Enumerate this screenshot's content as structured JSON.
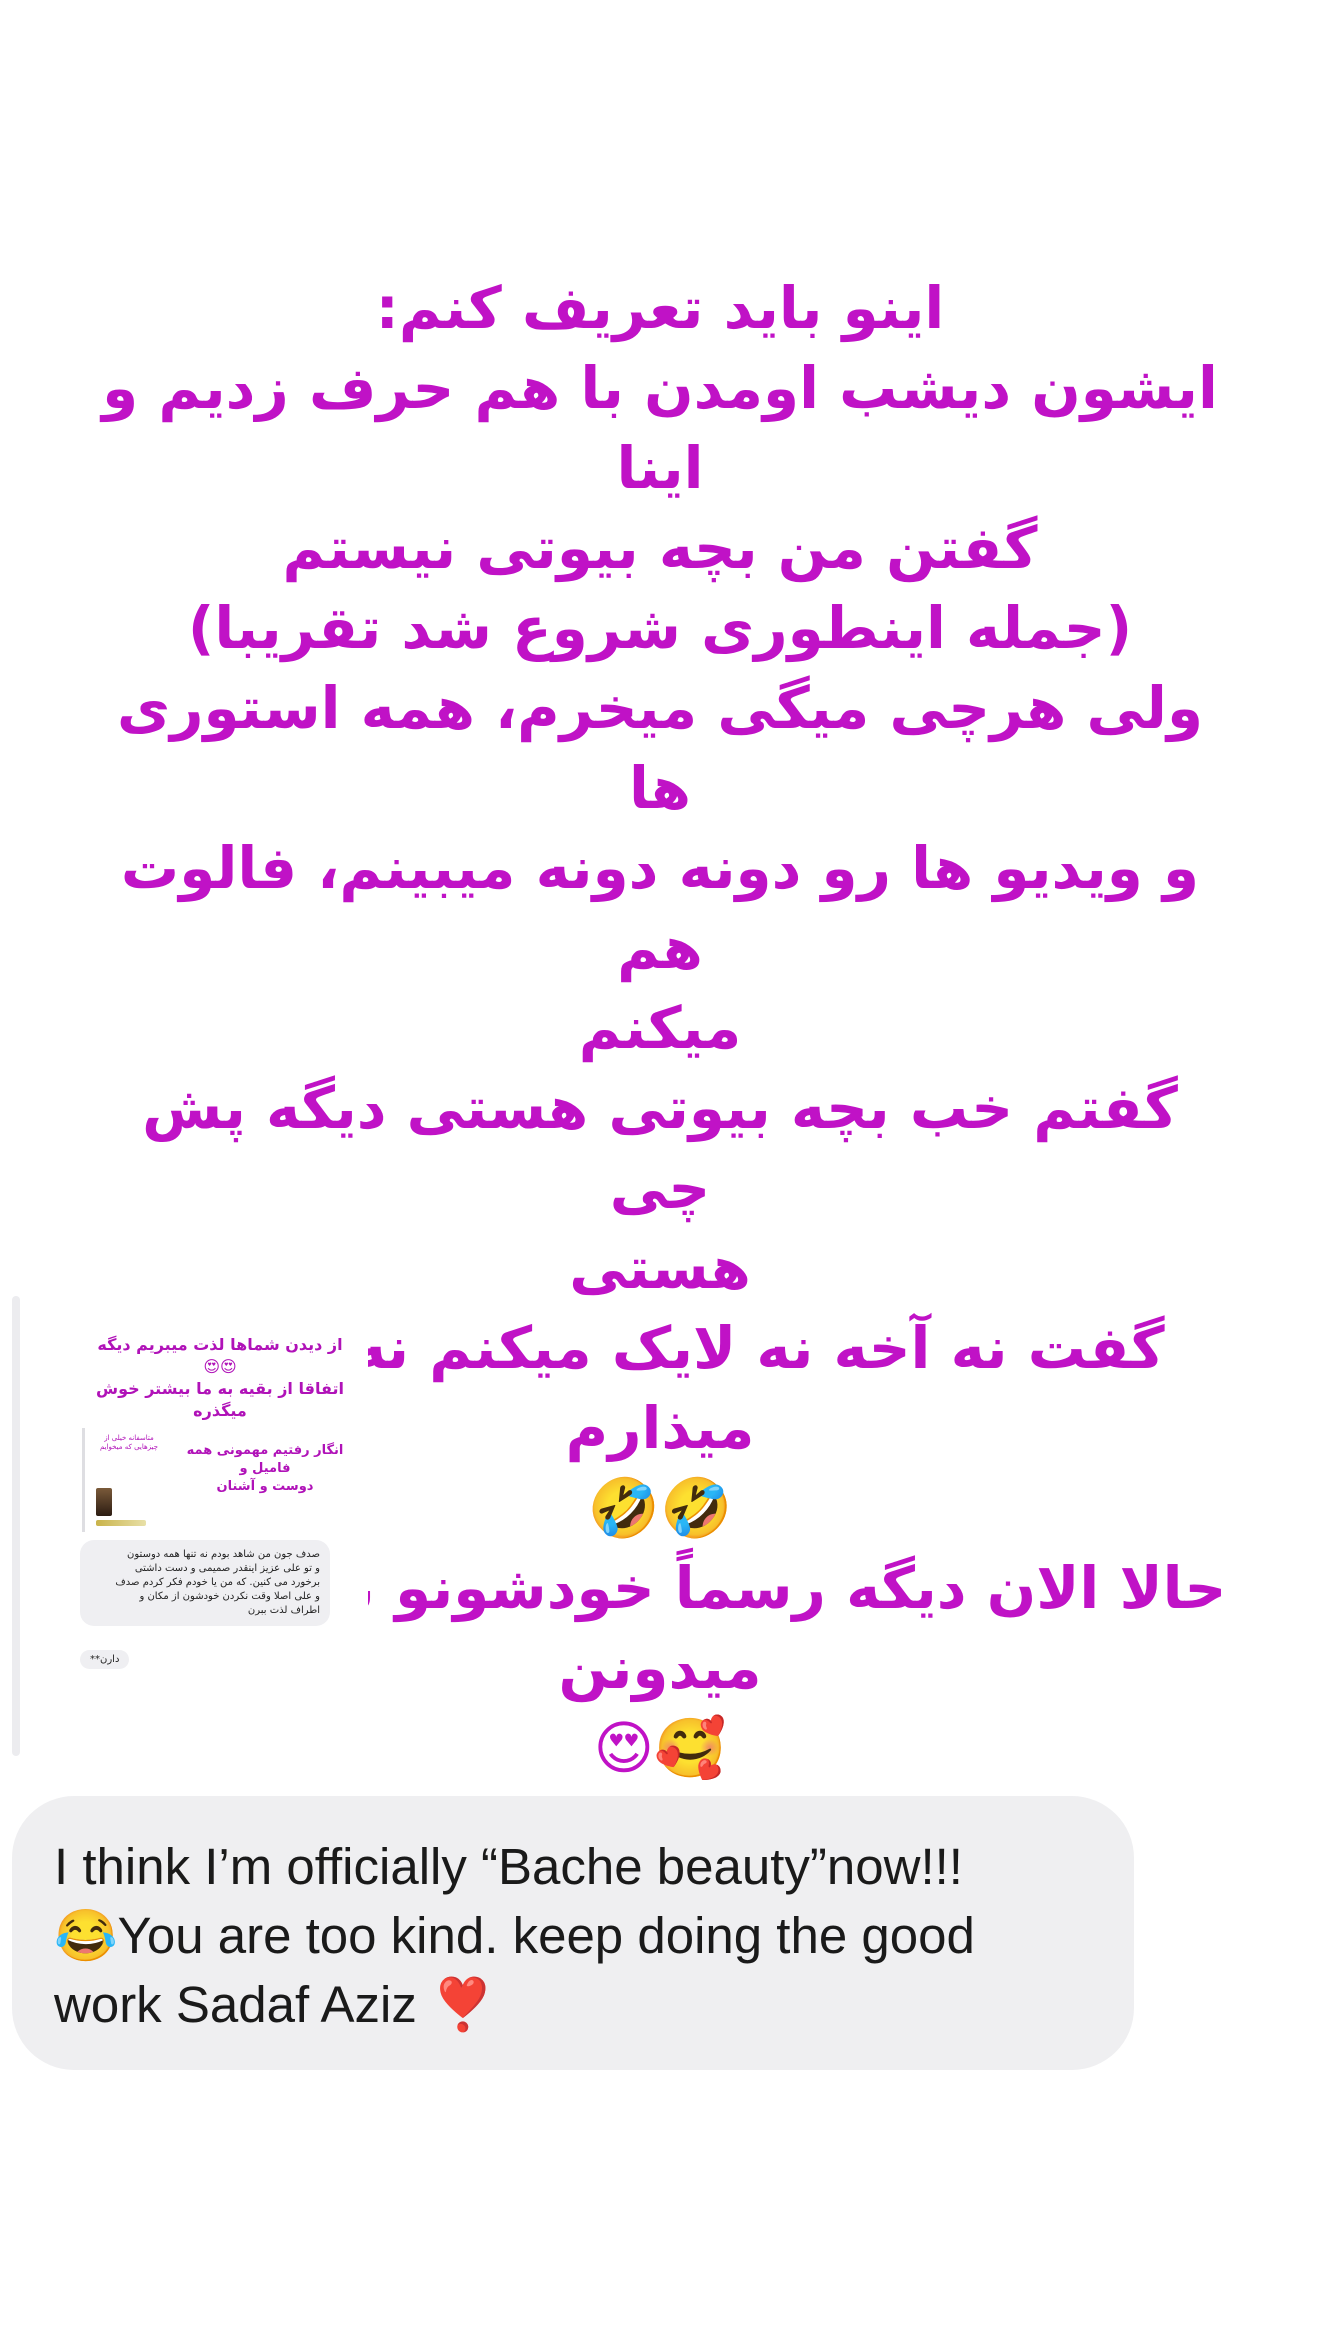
{
  "story": {
    "lines": [
      "اینو باید تعریف کنم:",
      "ایشون دیشب اومدن با هم حرف زدیم و اینا",
      "گفتن من بچه بیوتی نیستم",
      "(جمله اینطوری شروع شد تقریبا)",
      "ولی هرچی میگی میخرم، همه استوری ها",
      "و ویدیو ها رو دونه دونه میبینم، فالوت هم",
      "میکنم",
      "گفتم خب بچه بیوتی هستی دیگه پش چی",
      "هستی",
      "گفت نه آخه نه لایک میکنم نه کامنت میذارم",
      "🤣🤣",
      "حالا الان دیگه رسماً خودشونو بچه بیوتی",
      "میدونن",
      "🥰😍"
    ],
    "text_color": "#c012c6"
  },
  "replied_story": {
    "lines": [
      "از دیدن شماها لذت میبریم دیگه",
      "😍😍",
      "اتفاقا از بقیه به ما بیشتر خوش",
      "میگذره"
    ],
    "inner_tiny": "متاسفانه خیلی از چیزهایی که میخوایم",
    "inner_lines": [
      "انگار رفتیم مهمونی همه فامیل و",
      "دوست و آشنان"
    ],
    "message_lines": [
      "صدف جون من شاهد بودم نه تنها همه دوستون",
      "و تو علی عزیز اینقدر صمیمی و دست داشتی",
      "برخورد می کنین. که من یا خودم فکر کردم صدف",
      "و علی اصلا وقت نکردن خودشون از مکان و",
      "اطراف لذت ببرن"
    ],
    "pill": "دارن**"
  },
  "reply": {
    "lines": [
      "I think I’m officially “Bache beauty”now!!!",
      "😂You are too kind. keep doing the good",
      "work Sadaf Aziz ❣️"
    ]
  }
}
